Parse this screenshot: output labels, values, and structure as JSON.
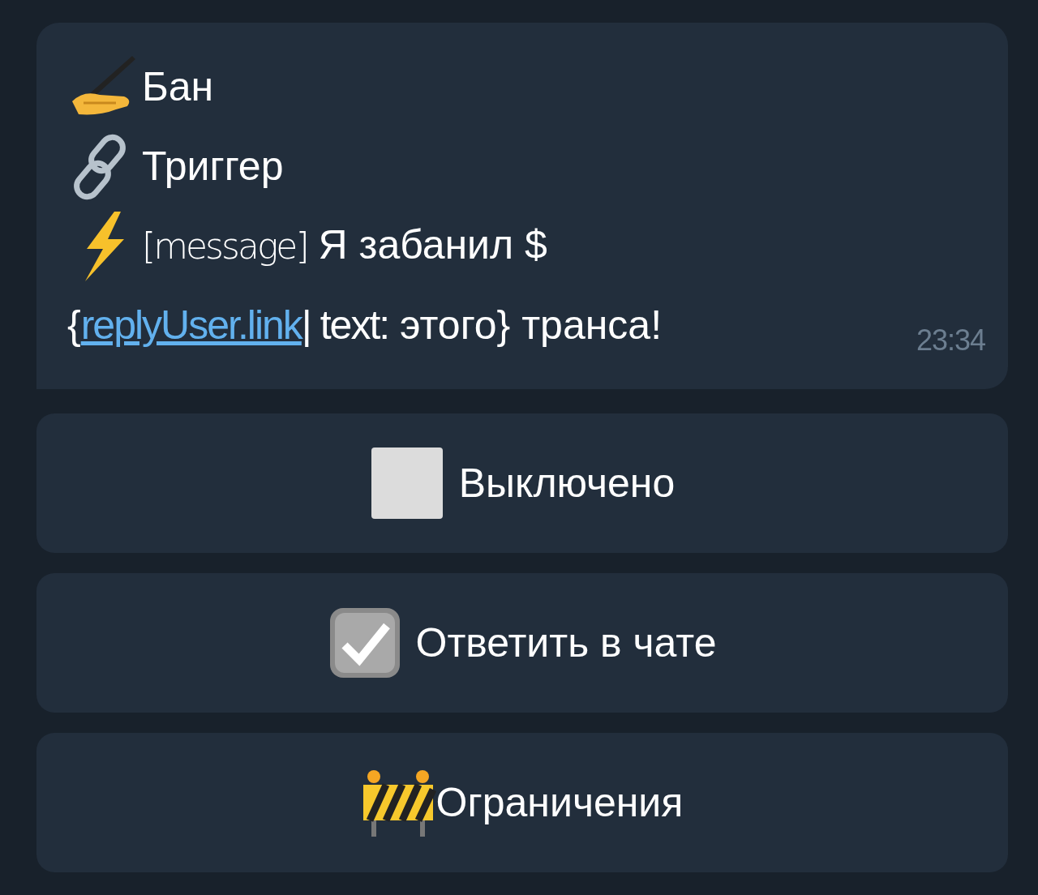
{
  "message": {
    "lines": [
      {
        "kind": "writing",
        "text": "Бан"
      },
      {
        "kind": "chain",
        "text": "Триггер"
      }
    ],
    "action": {
      "kind": "lightning",
      "tag": "[message]",
      "text": "Я забанил $",
      "open": "{",
      "link": "replyUser.link",
      "rest_tag": "| text:",
      "rest": "этого} транса!"
    },
    "time": "23:34"
  },
  "buttons": [
    {
      "kind": "checkbox",
      "checked": false,
      "label": "Выключено"
    },
    {
      "kind": "checkbox",
      "checked": true,
      "label": "Ответить в чате"
    },
    {
      "kind": "barrier",
      "label": "Ограничения"
    }
  ]
}
